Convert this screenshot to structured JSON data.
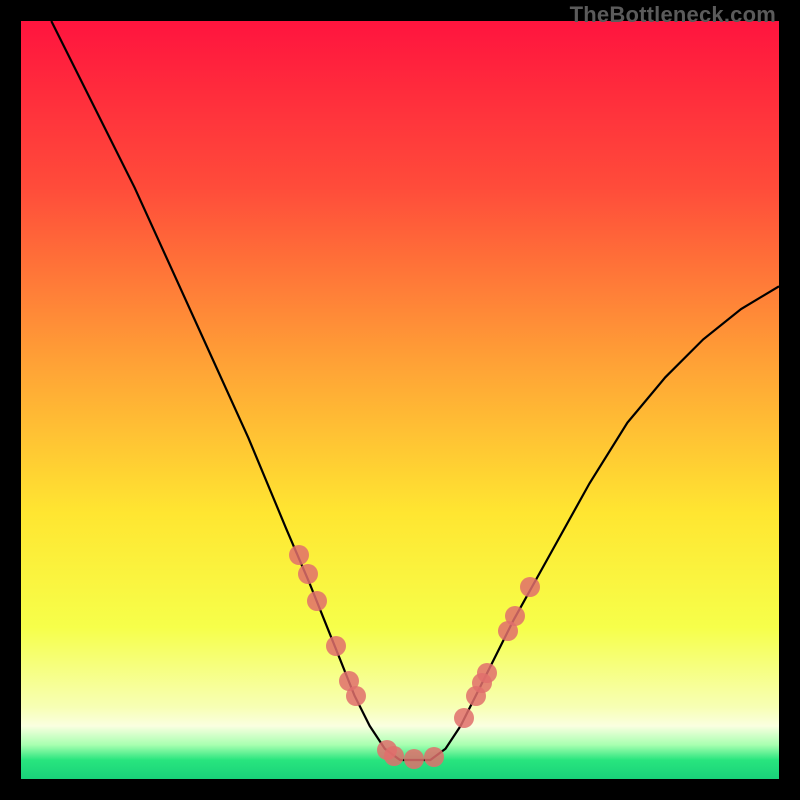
{
  "watermark": "TheBottleneck.com",
  "chart_data": {
    "type": "line",
    "title": "",
    "xlabel": "",
    "ylabel": "",
    "xlim": [
      0,
      100
    ],
    "ylim": [
      0,
      100
    ],
    "grid": false,
    "series": [
      {
        "name": "curve",
        "x": [
          4,
          10,
          15,
          20,
          25,
          30,
          35,
          38,
          40,
          42,
          44,
          46,
          48,
          50,
          52,
          54,
          56,
          58,
          60,
          65,
          70,
          75,
          80,
          85,
          90,
          95,
          100
        ],
        "y": [
          100,
          88,
          78,
          67,
          56,
          45,
          33,
          26,
          21,
          16,
          11,
          7,
          4,
          2.5,
          2.5,
          2.5,
          4,
          7,
          11,
          21,
          30,
          39,
          47,
          53,
          58,
          62,
          65
        ]
      }
    ],
    "markers": [
      {
        "x": 36.7,
        "y": 29.5
      },
      {
        "x": 37.8,
        "y": 27.0
      },
      {
        "x": 39.1,
        "y": 23.5
      },
      {
        "x": 41.5,
        "y": 17.5
      },
      {
        "x": 43.3,
        "y": 13.0
      },
      {
        "x": 44.2,
        "y": 11.0
      },
      {
        "x": 48.3,
        "y": 3.8
      },
      {
        "x": 49.2,
        "y": 3.0
      },
      {
        "x": 51.8,
        "y": 2.7
      },
      {
        "x": 54.5,
        "y": 2.9
      },
      {
        "x": 58.5,
        "y": 8.0
      },
      {
        "x": 60.0,
        "y": 11.0
      },
      {
        "x": 60.8,
        "y": 12.7
      },
      {
        "x": 61.5,
        "y": 14.0
      },
      {
        "x": 64.2,
        "y": 19.5
      },
      {
        "x": 65.2,
        "y": 21.5
      },
      {
        "x": 67.2,
        "y": 25.3
      }
    ],
    "background_gradient": {
      "stops": [
        {
          "offset": 0.0,
          "color": "#ff143e"
        },
        {
          "offset": 0.22,
          "color": "#ff4c3a"
        },
        {
          "offset": 0.45,
          "color": "#ffa136"
        },
        {
          "offset": 0.65,
          "color": "#ffe631"
        },
        {
          "offset": 0.8,
          "color": "#f6ff4a"
        },
        {
          "offset": 0.905,
          "color": "#f7ffb4"
        },
        {
          "offset": 0.93,
          "color": "#faffe0"
        },
        {
          "offset": 0.955,
          "color": "#a8ffb0"
        },
        {
          "offset": 0.975,
          "color": "#28e57e"
        },
        {
          "offset": 1.0,
          "color": "#19d27a"
        }
      ]
    }
  }
}
